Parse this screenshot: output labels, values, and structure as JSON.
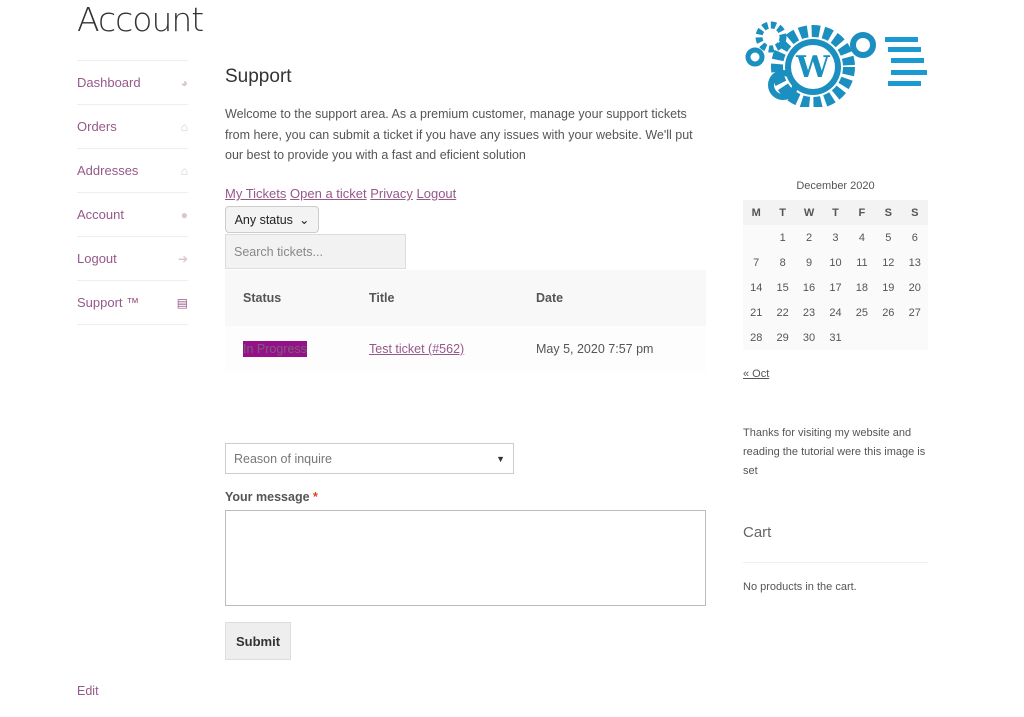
{
  "page_title": "Account",
  "nav": [
    {
      "label": "Dashboard",
      "icon": "dashboard-icon",
      "glyph": "◕"
    },
    {
      "label": "Orders",
      "icon": "basket-icon",
      "glyph": "⌂"
    },
    {
      "label": "Addresses",
      "icon": "home-icon",
      "glyph": "⌂"
    },
    {
      "label": "Account",
      "icon": "user-icon",
      "glyph": "●"
    },
    {
      "label": "Logout",
      "icon": "sign-out-icon",
      "glyph": "➔"
    },
    {
      "label": "Support ™",
      "icon": "file-icon",
      "glyph": "▤"
    }
  ],
  "support": {
    "heading": "Support",
    "intro": "Welcome to the support area. As a premium customer, manage your support tickets from here, you can submit a ticket if you have any issues with your website. We'll put our best to provide you with a fast and eficient solution",
    "links": [
      "My Tickets",
      "Open a ticket",
      "Privacy",
      "Logout"
    ],
    "status_filter": "Any status",
    "search_placeholder": "Search tickets...",
    "columns": [
      "Status",
      "Title",
      "Date"
    ],
    "tickets": [
      {
        "status": "In Progress",
        "title": "Test ticket (#562)",
        "date": "May 5, 2020 7:57 pm"
      }
    ],
    "reason_placeholder": "Reason of inquire",
    "message_label": "Your message",
    "required_mark": "*",
    "submit": "Submit"
  },
  "edit_link": "Edit",
  "sidebar": {
    "calendar": {
      "caption": "December 2020",
      "days": [
        "M",
        "T",
        "W",
        "T",
        "F",
        "S",
        "S"
      ],
      "weeks": [
        [
          "",
          "1",
          "2",
          "3",
          "4",
          "5",
          "6"
        ],
        [
          "7",
          "8",
          "9",
          "10",
          "11",
          "12",
          "13"
        ],
        [
          "14",
          "15",
          "16",
          "17",
          "18",
          "19",
          "20"
        ],
        [
          "21",
          "22",
          "23",
          "24",
          "25",
          "26",
          "27"
        ],
        [
          "28",
          "29",
          "30",
          "31",
          "",
          "",
          ""
        ]
      ],
      "prev": "« Oct"
    },
    "thanks": "Thanks for visiting my website and reading the tutorial were this image is set",
    "cart_title": "Cart",
    "cart_empty": "No products in the cart."
  },
  "colors": {
    "accent": "#96588a",
    "badge": "#96108a",
    "logo": "#1a8fc0"
  }
}
